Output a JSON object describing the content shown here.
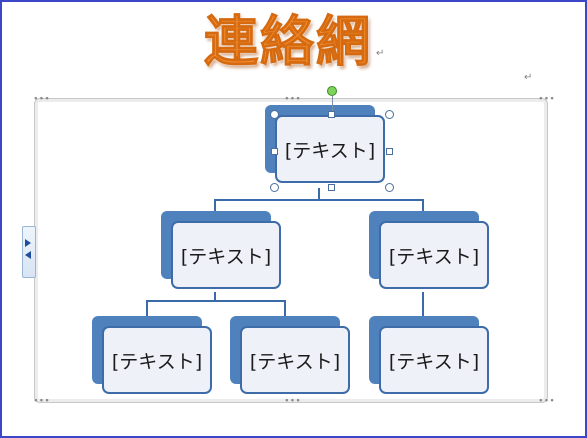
{
  "title": "連絡網",
  "para_mark": "↵",
  "node_text": "[テキスト]",
  "frame_dots": "∙∙∙",
  "icons": {
    "text_pane_expand": "triangle-right",
    "text_pane_collapse": "triangle-left",
    "rotate_handle": "green-circle"
  },
  "colors": {
    "title": "#f08a2c",
    "node_back": "#4f81bd",
    "node_border": "#3d6ca8",
    "node_fill": "#eef2f8",
    "page_border": "#3b46c8"
  },
  "org_chart": {
    "root": {
      "text": "[テキスト]"
    },
    "level2": [
      {
        "text": "[テキスト]",
        "children": [
          {
            "text": "[テキスト]"
          },
          {
            "text": "[テキスト]"
          }
        ]
      },
      {
        "text": "[テキスト]",
        "children": [
          {
            "text": "[テキスト]"
          }
        ]
      }
    ]
  }
}
